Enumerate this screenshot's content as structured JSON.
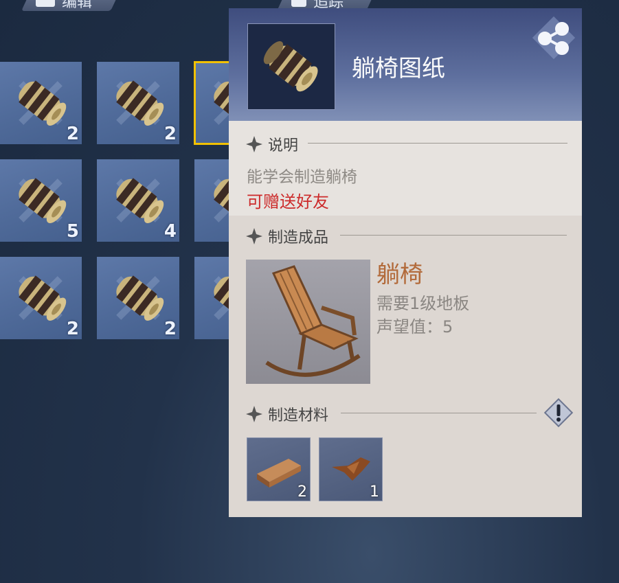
{
  "top_tabs": {
    "left_label": "编辑",
    "right_label": "追踪"
  },
  "inventory": {
    "slots": [
      {
        "count": "2"
      },
      {
        "count": "2"
      },
      {
        "count": "",
        "selected": true
      },
      {
        "count": "5"
      },
      {
        "count": "4"
      },
      {
        "count": ""
      },
      {
        "count": "2"
      },
      {
        "count": "2"
      },
      {
        "count": ""
      }
    ]
  },
  "item": {
    "name": "躺椅图纸",
    "description_header": "说明",
    "description": "能学会制造躺椅",
    "gift_note": "可赠送好友",
    "product_header": "制造成品",
    "product_name": "躺椅",
    "product_requirement": "需要1级地板",
    "product_reputation": "声望值：5",
    "materials_header": "制造材料",
    "materials": [
      {
        "icon": "wood-plank-icon",
        "count": "2"
      },
      {
        "icon": "leather-scrap-icon",
        "count": "1"
      }
    ]
  },
  "colors": {
    "accent_selected": "#f2c100",
    "gift_red": "#cc2a2a",
    "product_name": "#b26a3a"
  }
}
